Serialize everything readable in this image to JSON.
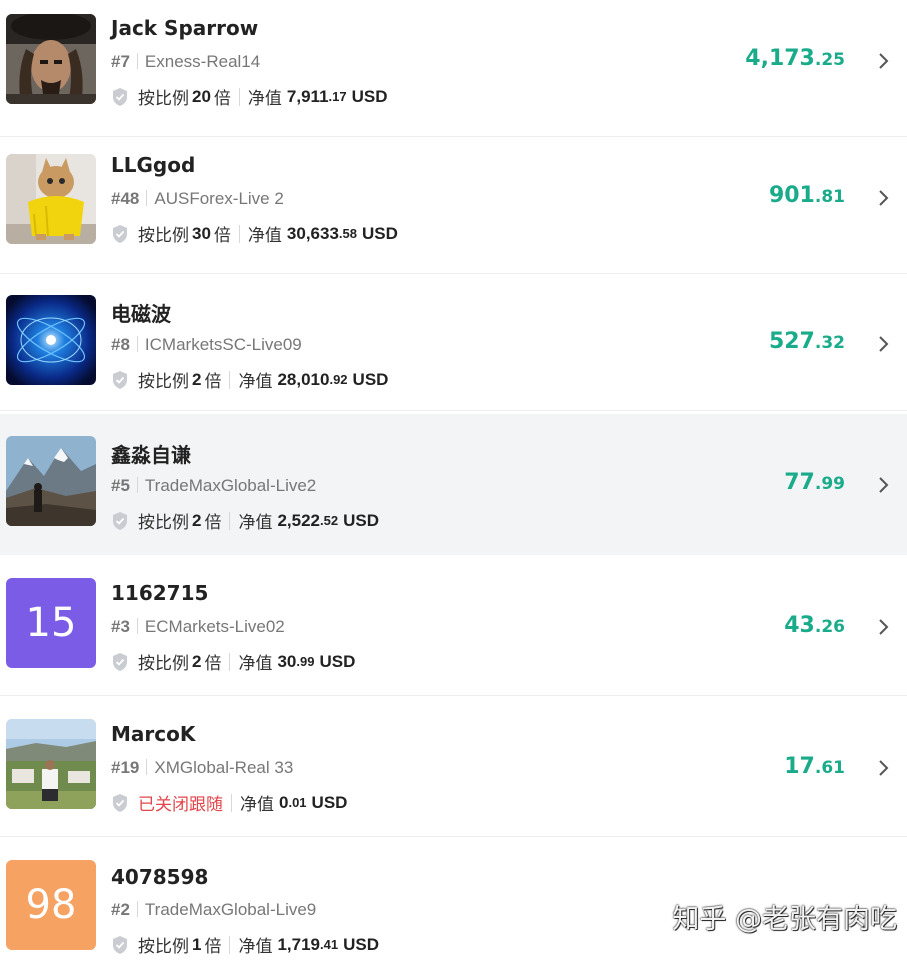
{
  "traders": [
    {
      "name": "Jack Sparrow",
      "rank": "#7",
      "broker": "Exness-Real14",
      "mode_prefix": "按比例",
      "multiplier": "20",
      "mode_suffix": "倍",
      "equity_label": "净值",
      "equity_int": "7,911",
      "equity_dec": ".17",
      "currency": "USD",
      "amount_int": "4,173",
      "amount_dec": ".25",
      "avatar_icon": "pirate-portrait"
    },
    {
      "name": "LLGgod",
      "rank": "#48",
      "broker": "AUSForex-Live 2",
      "mode_prefix": "按比例",
      "multiplier": "30",
      "mode_suffix": "倍",
      "equity_label": "净值",
      "equity_int": "30,633",
      "equity_dec": ".58",
      "currency": "USD",
      "amount_int": "901",
      "amount_dec": ".81",
      "avatar_icon": "cat-in-raincoat"
    },
    {
      "name": "电磁波",
      "rank": "#8",
      "broker": "ICMarketsSC-Live09",
      "mode_prefix": "按比例",
      "multiplier": "2",
      "mode_suffix": "倍",
      "equity_label": "净值",
      "equity_int": "28,010",
      "equity_dec": ".92",
      "currency": "USD",
      "amount_int": "527",
      "amount_dec": ".32",
      "avatar_icon": "electromagnetic-field"
    },
    {
      "name": "鑫淼自谦",
      "rank": "#5",
      "broker": "TradeMaxGlobal-Live2",
      "mode_prefix": "按比例",
      "multiplier": "2",
      "mode_suffix": "倍",
      "equity_label": "净值",
      "equity_int": "2,522",
      "equity_dec": ".52",
      "currency": "USD",
      "amount_int": "77",
      "amount_dec": ".99",
      "avatar_icon": "mountain-hiker",
      "highlighted": true
    },
    {
      "name": "1162715",
      "rank": "#3",
      "broker": "ECMarkets-Live02",
      "mode_prefix": "按比例",
      "multiplier": "2",
      "mode_suffix": "倍",
      "equity_label": "净值",
      "equity_int": "30",
      "equity_dec": ".99",
      "currency": "USD",
      "amount_int": "43",
      "amount_dec": ".26",
      "avatar_text": "15",
      "avatar_color": "#7b5ce6"
    },
    {
      "name": "MarcoK",
      "rank": "#19",
      "broker": "XMGlobal-Real 33",
      "status_text": "已关闭跟随",
      "equity_label": "净值",
      "equity_int": "0",
      "equity_dec": ".01",
      "currency": "USD",
      "amount_int": "17",
      "amount_dec": ".61",
      "avatar_icon": "landscape-person"
    },
    {
      "name": "4078598",
      "rank": "#2",
      "broker": "TradeMaxGlobal-Live9",
      "mode_prefix": "按比例",
      "multiplier": "1",
      "mode_suffix": "倍",
      "equity_label": "净值",
      "equity_int": "1,719",
      "equity_dec": ".41",
      "currency": "USD",
      "amount_int": "",
      "amount_dec": "",
      "avatar_text": "98",
      "avatar_color": "#f5a263"
    }
  ],
  "watermark": "知乎 @老张有肉吃",
  "colors": {
    "amount_green": "#1aab8a",
    "closed_red": "#e2454a",
    "highlight_bg": "#f2f4f6"
  }
}
